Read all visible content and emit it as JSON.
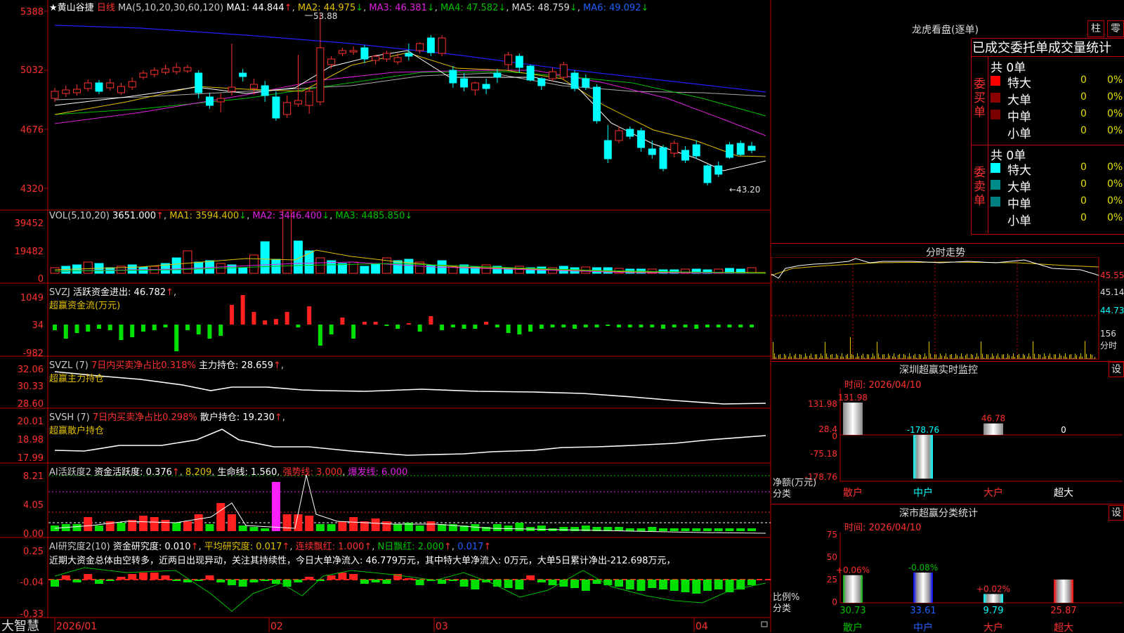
{
  "stock": {
    "name": "黄山谷捷",
    "period": "日线",
    "star": "★"
  },
  "main": {
    "ma_header": "MA(5,10,20,30,60,120)",
    "ma1": "MA1: 44.844",
    "ma2": "MA2: 44.975",
    "ma3": "MA3: 46.381",
    "ma4": "MA4: 47.582",
    "ma5": "MA5: 48.759",
    "ma6": "MA6: 49.092",
    "y_ticks": [
      "5388",
      "5032",
      "4676",
      "4320"
    ],
    "high_label": "53.88",
    "low_label": "←43.20"
  },
  "vol": {
    "header": "VOL(5,10,20)",
    "value": "3651.000",
    "ma1": "MA1: 3594.400",
    "ma2": "MA2: 3446.400",
    "ma3": "MA3: 4485.850",
    "y_ticks": [
      "39452",
      "19482",
      "0"
    ]
  },
  "svzj": {
    "header": "SVZJ",
    "value": "活跃资金进出: 46.782",
    "sub": "超赢资金流(万元)",
    "y_ticks": [
      "1049",
      "34",
      "-982"
    ]
  },
  "svzl": {
    "header": "SVZL (7)",
    "pct": "7日内买卖净占比0.318%",
    "hold": "主力持仓: 28.659",
    "sub": "超赢主力持仓",
    "y_ticks": [
      "32.06",
      "30.33",
      "28.60"
    ]
  },
  "svsh": {
    "header": "SVSH (7)",
    "pct": "7日内买卖净占比0.298%",
    "hold": "散户持仓: 19.230",
    "sub": "超赢散户持仓",
    "y_ticks": [
      "20.01",
      "18.98",
      "17.99"
    ]
  },
  "ai1": {
    "header": "AI活跃度2",
    "a": "资金活跃度: 0.376",
    "b": "8.209",
    "c": "生命线: 1.560",
    "d": "强势线: 3.000",
    "e": "爆发线: 6.000",
    "y_ticks": [
      "8.21",
      "4.05",
      "0.00"
    ]
  },
  "ai2": {
    "header": "AI研究度2(10)",
    "a": "资金研究度: 0.010",
    "b": "平均研究度: 0.017",
    "c": "连续飘红: 1.000",
    "d": "N日飘红: 2.000",
    "e": "0.017",
    "note": "近期大资金总体由空转多，近两日出现异动，关注其持续性，今日大单净流入: 46.779万元，其中特大单净流入: 0万元，大单5日累计净出-212.698万元，",
    "y_ticks": [
      "0.25",
      "-0.04",
      "-0.33"
    ]
  },
  "x_axis": {
    "labels": [
      "2026/01",
      "02",
      "03",
      "04"
    ],
    "brand": "大智慧"
  },
  "dragon": {
    "title": "龙虎看盘(逐单)",
    "btn1": "柱",
    "btn2": "零",
    "subtitle": "已成交委托单成交量统计",
    "buy_label": "委买单",
    "buy_total": "共 0单",
    "sell_label": "委卖单",
    "sell_total": "共 0单",
    "rows": [
      {
        "name": "特大",
        "count": "0",
        "pct": "0%"
      },
      {
        "name": "大单",
        "count": "0",
        "pct": "0%"
      },
      {
        "name": "中单",
        "count": "0",
        "pct": "0%"
      },
      {
        "name": "小单",
        "count": "0",
        "pct": "0%"
      }
    ],
    "buy_colors": [
      "#ff0000",
      "#8b0000",
      "#7a0000",
      "#000000"
    ],
    "sell_colors": [
      "#00ffff",
      "#008b8b",
      "#008080",
      "#000000"
    ]
  },
  "intraday": {
    "title": "分时走势",
    "y_ticks": [
      "45.55",
      "45.14",
      "44.73"
    ],
    "vol_tick": "156",
    "vol_label": "分时"
  },
  "sz_monitor": {
    "title": "深圳超赢实时监控",
    "btn": "设",
    "time": "时间: 2026/04/10",
    "y_ticks": [
      "131.98",
      "28.4",
      "0",
      "-75.18",
      "-178.76"
    ],
    "bars": [
      {
        "label": "散户",
        "value": "131.98"
      },
      {
        "label": "中户",
        "value": "-178.76"
      },
      {
        "label": "大户",
        "value": "46.78"
      },
      {
        "label": "超大",
        "value": "0"
      }
    ],
    "ylabel": "净额(万元)",
    "xlabel": "分类"
  },
  "sz_stats": {
    "title": "深市超赢分类统计",
    "btn": "设",
    "time": "时间: 2026/04/10",
    "y_ticks": [
      "75",
      "50",
      "25",
      "0"
    ],
    "bars": [
      {
        "label": "散户",
        "value": "30.73",
        "delta": "+0.06%"
      },
      {
        "label": "中户",
        "value": "33.61",
        "delta": "-0.08%"
      },
      {
        "label": "大户",
        "value": "9.79",
        "delta": "+0.02%"
      },
      {
        "label": "超大",
        "value": "25.87",
        "delta": ""
      }
    ],
    "ylabel": "比例%",
    "xlabel": "分类"
  }
}
